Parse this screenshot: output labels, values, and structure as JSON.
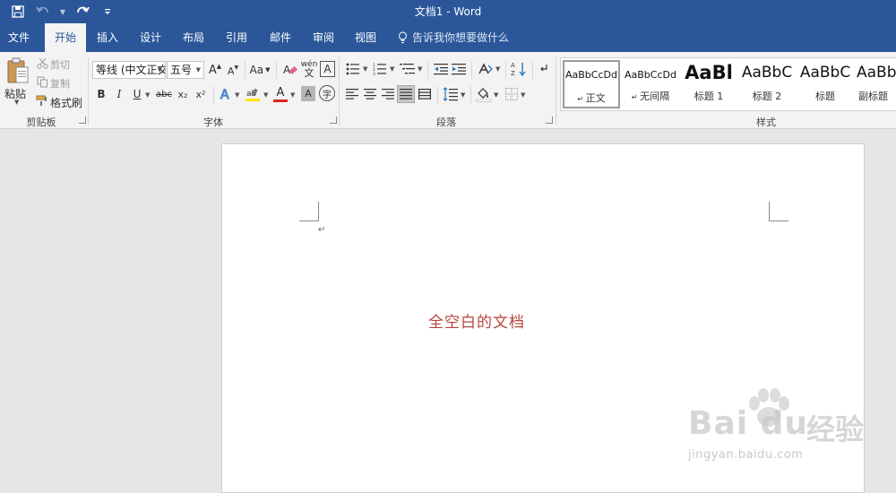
{
  "window": {
    "title": "文档1  -  Word"
  },
  "tabs": [
    {
      "label": "文件"
    },
    {
      "label": "开始"
    },
    {
      "label": "插入"
    },
    {
      "label": "设计"
    },
    {
      "label": "布局"
    },
    {
      "label": "引用"
    },
    {
      "label": "邮件"
    },
    {
      "label": "审阅"
    },
    {
      "label": "视图"
    }
  ],
  "tell_me": {
    "placeholder": "告诉我你想要做什么"
  },
  "clipboard": {
    "paste": "粘贴",
    "cut": "剪切",
    "copy": "复制",
    "format_painter": "格式刷",
    "group": "剪贴板"
  },
  "font": {
    "name": "等线 (中文正文)",
    "size": "五号",
    "grow": "A",
    "shrink": "A",
    "case": "Aa",
    "group": "字体",
    "bold": "B",
    "italic": "I",
    "underline": "U",
    "strike": "abc",
    "sub": "x₂",
    "sup": "x²",
    "phonetic": "wén",
    "char_border": "A",
    "font_color_glyph": "A",
    "shading_glyph": "A",
    "enclose": "字"
  },
  "paragraph": {
    "group": "段落"
  },
  "styles": {
    "group": "样式",
    "items": [
      {
        "preview": "AaBbCcDd",
        "name": "正文"
      },
      {
        "preview": "AaBbCcDd",
        "name": "无间隔"
      },
      {
        "preview": "AaBl",
        "name": "标题 1"
      },
      {
        "preview": "AaBbC",
        "name": "标题 2"
      },
      {
        "preview": "AaBbC",
        "name": "标题"
      },
      {
        "preview": "AaBb",
        "name": "副标题"
      }
    ]
  },
  "document": {
    "body_text": "全空白的文档",
    "paragraph_mark": "↵"
  },
  "watermark": {
    "brand": "Bai du",
    "cn": "经验",
    "url": "jingyan.baidu.com"
  },
  "colors": {
    "brand": "#2b579a",
    "text_red": "#b5453a",
    "highlight": "#ffe600",
    "font_color": "#d9261c"
  }
}
